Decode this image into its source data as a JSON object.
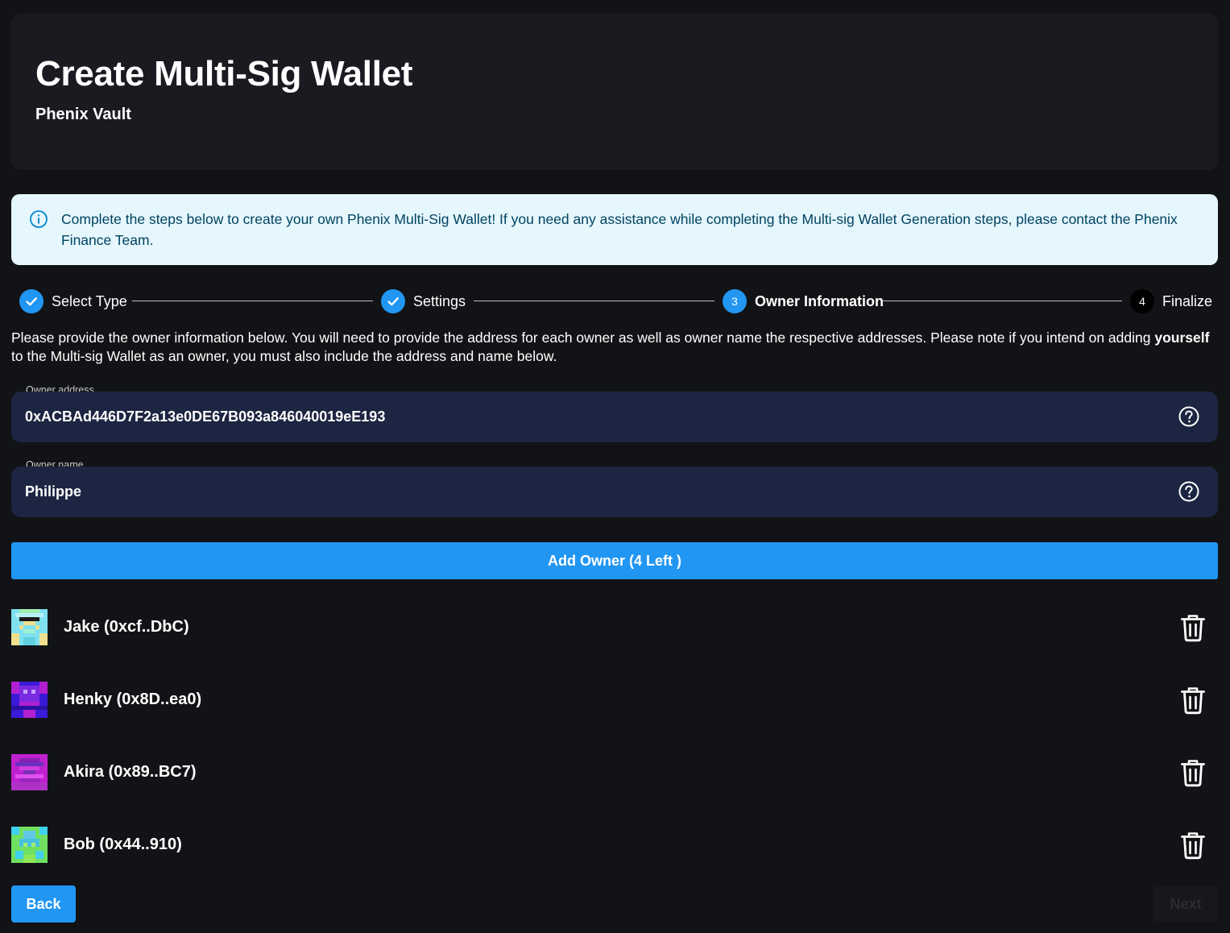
{
  "header": {
    "title": "Create Multi-Sig Wallet",
    "subtitle": "Phenix Vault"
  },
  "alert": {
    "icon": "info-icon",
    "text": "Complete the steps below to create your own Phenix Multi-Sig Wallet! If you need any assistance while completing the Multi-sig Wallet Generation steps, please contact the Phenix Finance Team."
  },
  "stepper": {
    "steps": [
      {
        "label": "Select Type",
        "state": "completed",
        "icon": "check-icon"
      },
      {
        "label": "Settings",
        "state": "completed",
        "icon": "check-icon"
      },
      {
        "label": "Owner Information",
        "state": "active",
        "number": "3"
      },
      {
        "label": "Finalize",
        "state": "pending",
        "number": "4"
      }
    ]
  },
  "instructions": {
    "before": "Please provide the owner information below. You will need to provide the address for each owner as well as owner name the respective addresses. Please note if you intend on adding ",
    "emphasis": "yourself",
    "after": " to the Multi-sig Wallet as an owner, you must also include the address and name below."
  },
  "form": {
    "address": {
      "label": "Owner address",
      "value": "0xACBAd446D7F2a13e0DE67B093a846040019eE193"
    },
    "name": {
      "label": "Owner name",
      "value": "Philippe"
    }
  },
  "add_owner_label": "Add Owner (4 Left )",
  "owners": [
    {
      "label": "Jake (0xcf..DbC)"
    },
    {
      "label": "Henky (0x8D..ea0)"
    },
    {
      "label": "Akira (0x89..BC7)"
    },
    {
      "label": "Bob (0x44..910)"
    }
  ],
  "nav": {
    "back_label": "Back",
    "next_label": "Next"
  },
  "colors": {
    "accent": "#2196f3",
    "background": "#121316",
    "card": "#1a1b20",
    "input": "#1c2541",
    "alert_bg": "#e5f6fd",
    "alert_text": "#014361"
  }
}
